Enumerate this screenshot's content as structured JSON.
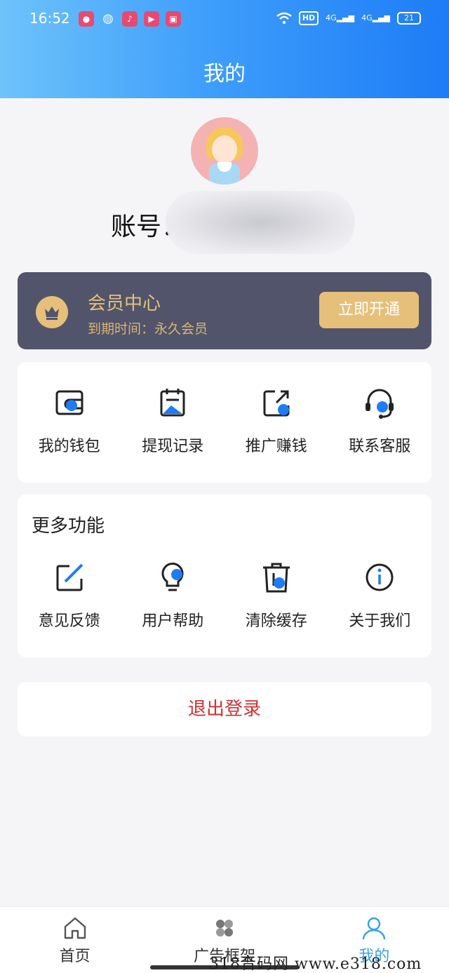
{
  "status_bar": {
    "time": "16:52",
    "battery": "21",
    "hd": "HD",
    "signal1": "4G",
    "signal2": "4G"
  },
  "header": {
    "title": "我的"
  },
  "profile": {
    "account_label": "账号："
  },
  "vip": {
    "title": "会员中心",
    "expiry": "到期时间：永久会员",
    "button": "立即开通"
  },
  "quick_actions": [
    {
      "label": "我的钱包",
      "icon": "wallet-icon"
    },
    {
      "label": "提现记录",
      "icon": "withdraw-record-icon"
    },
    {
      "label": "推广赚钱",
      "icon": "share-icon"
    },
    {
      "label": "联系客服",
      "icon": "headset-icon"
    }
  ],
  "more": {
    "title": "更多功能",
    "items": [
      {
        "label": "意见反馈",
        "icon": "feedback-icon"
      },
      {
        "label": "用户帮助",
        "icon": "lightbulb-icon"
      },
      {
        "label": "清除缓存",
        "icon": "trash-icon"
      },
      {
        "label": "关于我们",
        "icon": "info-icon"
      }
    ]
  },
  "logout": {
    "label": "退出登录"
  },
  "tabbar": [
    {
      "label": "首页",
      "icon": "home-icon"
    },
    {
      "label": "广告框架",
      "icon": "grid-icon"
    },
    {
      "label": "我的",
      "icon": "user-icon"
    }
  ],
  "watermark": "318音码网  www.e318.com",
  "colors": {
    "accent": "#1e7cf6",
    "gold": "#e6c07a",
    "vip_bg": "#51546a",
    "logout": "#d32f2f",
    "tab_active": "#3aa0e8"
  }
}
